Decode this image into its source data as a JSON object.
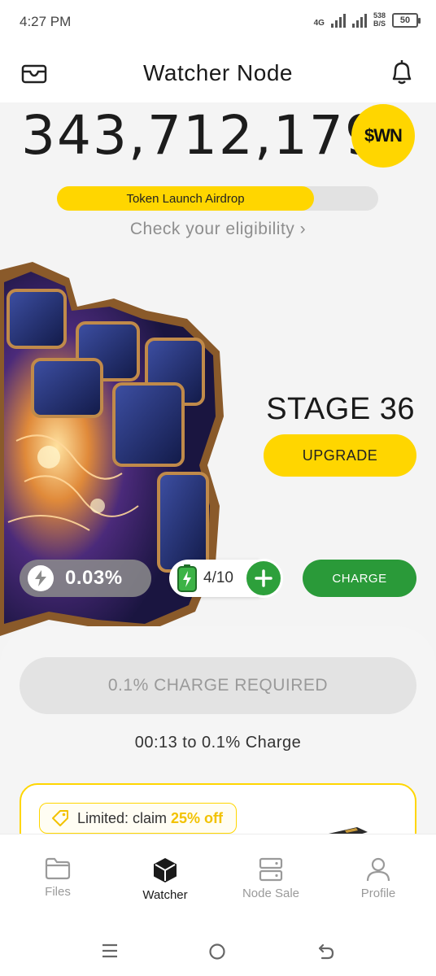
{
  "status_bar": {
    "time": "4:27 PM",
    "network": "4G",
    "speed_value": "538",
    "speed_unit": "B/S",
    "battery": "50"
  },
  "header": {
    "title": "Watcher Node",
    "left_icon": "wallet-icon",
    "right_icon": "bell-icon"
  },
  "balance": {
    "amount": "343,712,179",
    "token": "$WN",
    "token_color": "#ffd600"
  },
  "airdrop": {
    "label": "Token Launch Airdrop",
    "progress": 0.8,
    "link": "Check your eligibility ›"
  },
  "node": {
    "stage": "STAGE 36",
    "upgrade_label": "UPGRADE",
    "rate": "0.03%",
    "charges": "4/10",
    "charge_label": "CHARGE"
  },
  "charge_panel": {
    "required_label": "0.1% CHARGE REQUIRED",
    "countdown": "00:13 to 0.1% Charge"
  },
  "promo": {
    "prefix": "Limited: claim ",
    "highlight": "25% off"
  },
  "bottom_nav": {
    "items": [
      {
        "label": "Files",
        "icon": "folder-icon"
      },
      {
        "label": "Watcher",
        "icon": "cube-icon",
        "active": true
      },
      {
        "label": "Node Sale",
        "icon": "server-icon"
      },
      {
        "label": "Profile",
        "icon": "user-icon"
      }
    ]
  },
  "colors": {
    "accent": "#ffd600",
    "green": "#2a9a39"
  }
}
